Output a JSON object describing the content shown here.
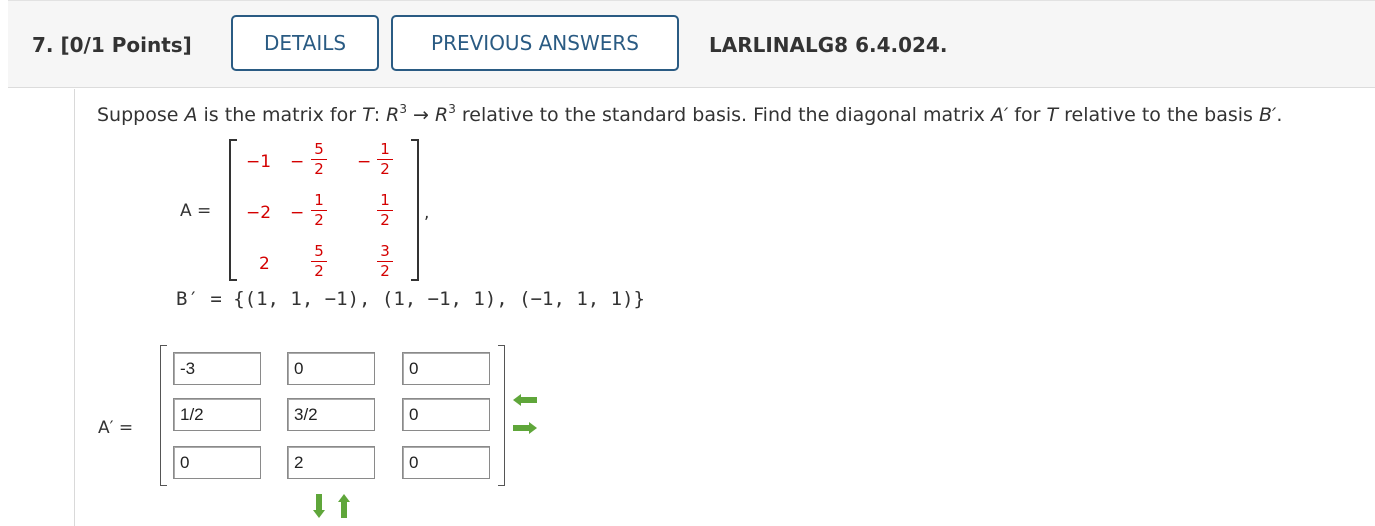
{
  "header": {
    "question_number": "7.",
    "points": "[0/1 Points]",
    "details_label": "DETAILS",
    "previous_answers_label": "PREVIOUS ANSWERS",
    "reference": "LARLINALG8 6.4.024."
  },
  "prompt": {
    "p1": "Suppose ",
    "A": "A",
    "p2": " is the matrix for ",
    "T": "T",
    "colon": ": ",
    "R1": "R",
    "exp1": "3",
    "arrow": " → ",
    "R2": "R",
    "exp2": "3",
    "p3": " relative to the standard basis. Find the diagonal matrix ",
    "Aprime": "A′",
    "p4": " for ",
    "T2": "T",
    "p5": " relative to the basis ",
    "Bprime": "B′",
    "p6": "."
  },
  "matrix_A": {
    "label": "A =",
    "comma": ",",
    "r1c1": "−1",
    "r1c2_num": "5",
    "r1c2_den": "2",
    "r1c3_num": "1",
    "r1c3_den": "2",
    "r2c1": "−2",
    "r2c2_num": "1",
    "r2c2_den": "2",
    "r2c3_num": "1",
    "r2c3_den": "2",
    "r3c1": "2",
    "r3c2_num": "5",
    "r3c2_den": "2",
    "r3c3_num": "3",
    "r3c3_den": "2",
    "minus": "−"
  },
  "basis": {
    "text": "B′ = {(1, 1, −1), (1, −1, 1), (−1, 1, 1)}"
  },
  "answer": {
    "label": "A′ =",
    "cells": [
      "-3",
      "0",
      "0",
      "1/2",
      "3/2",
      "0",
      "0",
      "2",
      "0"
    ]
  },
  "colors": {
    "accent": "#2a5b83",
    "matrix_red": "#d40000",
    "arrow_green": "#5fa63a"
  }
}
